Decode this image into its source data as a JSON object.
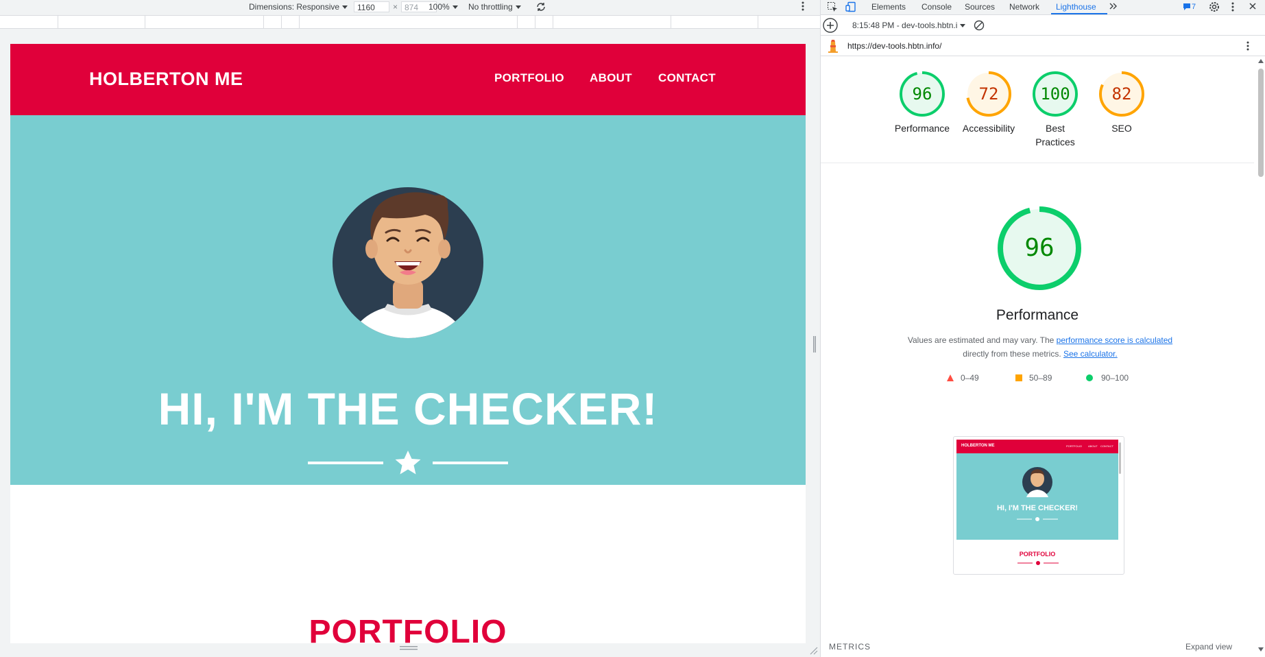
{
  "device_toolbar": {
    "dimensions_label": "Dimensions: Responsive",
    "width_value": "1160",
    "height_placeholder": "874",
    "times_sign": "×",
    "zoom": "100%",
    "throttling": "No throttling"
  },
  "website": {
    "logo": "HOLBERTON ME",
    "nav": [
      "PORTFOLIO",
      "ABOUT",
      "CONTACT"
    ],
    "hero_title": "HI, I'M THE CHECKER!",
    "section_title": "PORTFOLIO"
  },
  "devtools": {
    "tabs": [
      "Elements",
      "Console",
      "Sources",
      "Network",
      "Lighthouse"
    ],
    "active_tab": "Lighthouse",
    "issues_count": "7",
    "report_selector": "8:15:48 PM - dev-tools.hbtn.i",
    "url": "https://dev-tools.hbtn.info/"
  },
  "lighthouse": {
    "scores": [
      {
        "label": "Performance",
        "value": 96,
        "color": "#0cce6b"
      },
      {
        "label": "Accessibility",
        "value": 72,
        "color": "#ffa400"
      },
      {
        "label": "Best Practices",
        "value": 100,
        "color": "#0cce6b"
      },
      {
        "label": "SEO",
        "value": 82,
        "color": "#ffa400"
      }
    ],
    "main_score": 96,
    "main_title": "Performance",
    "desc_prefix": "Values are estimated and may vary. The ",
    "desc_link1": "performance score is calculated",
    "desc_middle": "directly from these metrics. ",
    "desc_link2": "See calculator.",
    "legend": [
      "0–49",
      "50–89",
      "90–100"
    ],
    "thumbnail": {
      "logo": "HOLBERTON ME",
      "nav": [
        "PORTFOLIO",
        "ABOUT",
        "CONTACT"
      ],
      "hero_title": "HI, I'M THE CHECKER!",
      "section_title": "PORTFOLIO"
    },
    "metrics_label": "METRICS",
    "expand_view": "Expand view"
  },
  "colors": {
    "brand_red": "#e0003a",
    "hero_teal": "#79cdd0",
    "pass_green": "#0cce6b",
    "average_orange": "#ffa400",
    "fail_red": "#ff4e42",
    "link_blue": "#1a73e8"
  }
}
